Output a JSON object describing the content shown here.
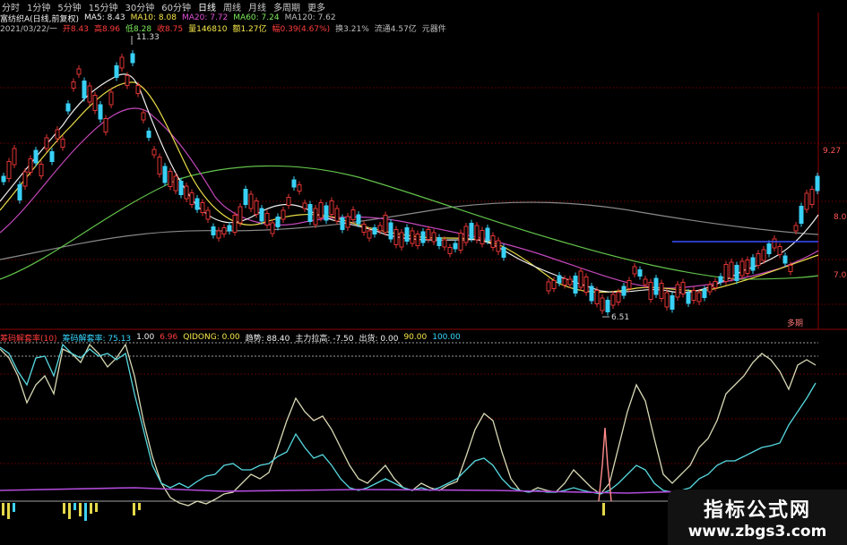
{
  "toolbar": {
    "label": "分时",
    "periods": [
      "1分钟",
      "5分钟",
      "15分钟",
      "30分钟",
      "60分钟",
      "日线",
      "周线",
      "月线",
      "多周期",
      "更多"
    ],
    "active": "日线"
  },
  "main_info": {
    "name": "富纺织A(日线,前复权)",
    "ma5": "MA5: 8.43",
    "ma10": "MA10: 8.08",
    "ma20": "MA20: 7.72",
    "ma60": "MA60: 7.24",
    "ma120": "MA120: 7.62"
  },
  "quote_info": {
    "date": "2021/03/22/一",
    "open": "开8.43",
    "high": "高8.96",
    "low": "低8.28",
    "close": "收8.75",
    "volume": "量146810",
    "amount": "额1.27亿",
    "change": "幅0.39(4.67%)",
    "turnover": "换3.21%",
    "float": "流通4.57亿",
    "extra": "元器件"
  },
  "price_labels": {
    "high": "11.33",
    "low": "6.51",
    "right_top": "9.27",
    "right_mid": "8.00",
    "right_low": "7.00",
    "marker": "多期"
  },
  "indicator_info": {
    "name": "筹码解套率(10)",
    "line1": "筹码解套率: 75.13",
    "v1": "1.00",
    "v2": "6.96",
    "qidong": "QIDONG: 0.00",
    "trend": "趋势: 88.40",
    "main": "主力拉高: -7.50",
    "out": "出货: 0.00",
    "c1": "90.00",
    "c2": "100.00"
  },
  "watermark": {
    "line1": "指标公式网",
    "line2": "www.zbgs3.com"
  },
  "colors": {
    "up": "#ff3b3b",
    "down": "#35d7ff",
    "ma5": "#f2f2f2",
    "ma10": "#f7e64a",
    "ma20": "#e24fd9",
    "ma60": "#7dea5b",
    "ma120": "#8a8a8a"
  }
}
